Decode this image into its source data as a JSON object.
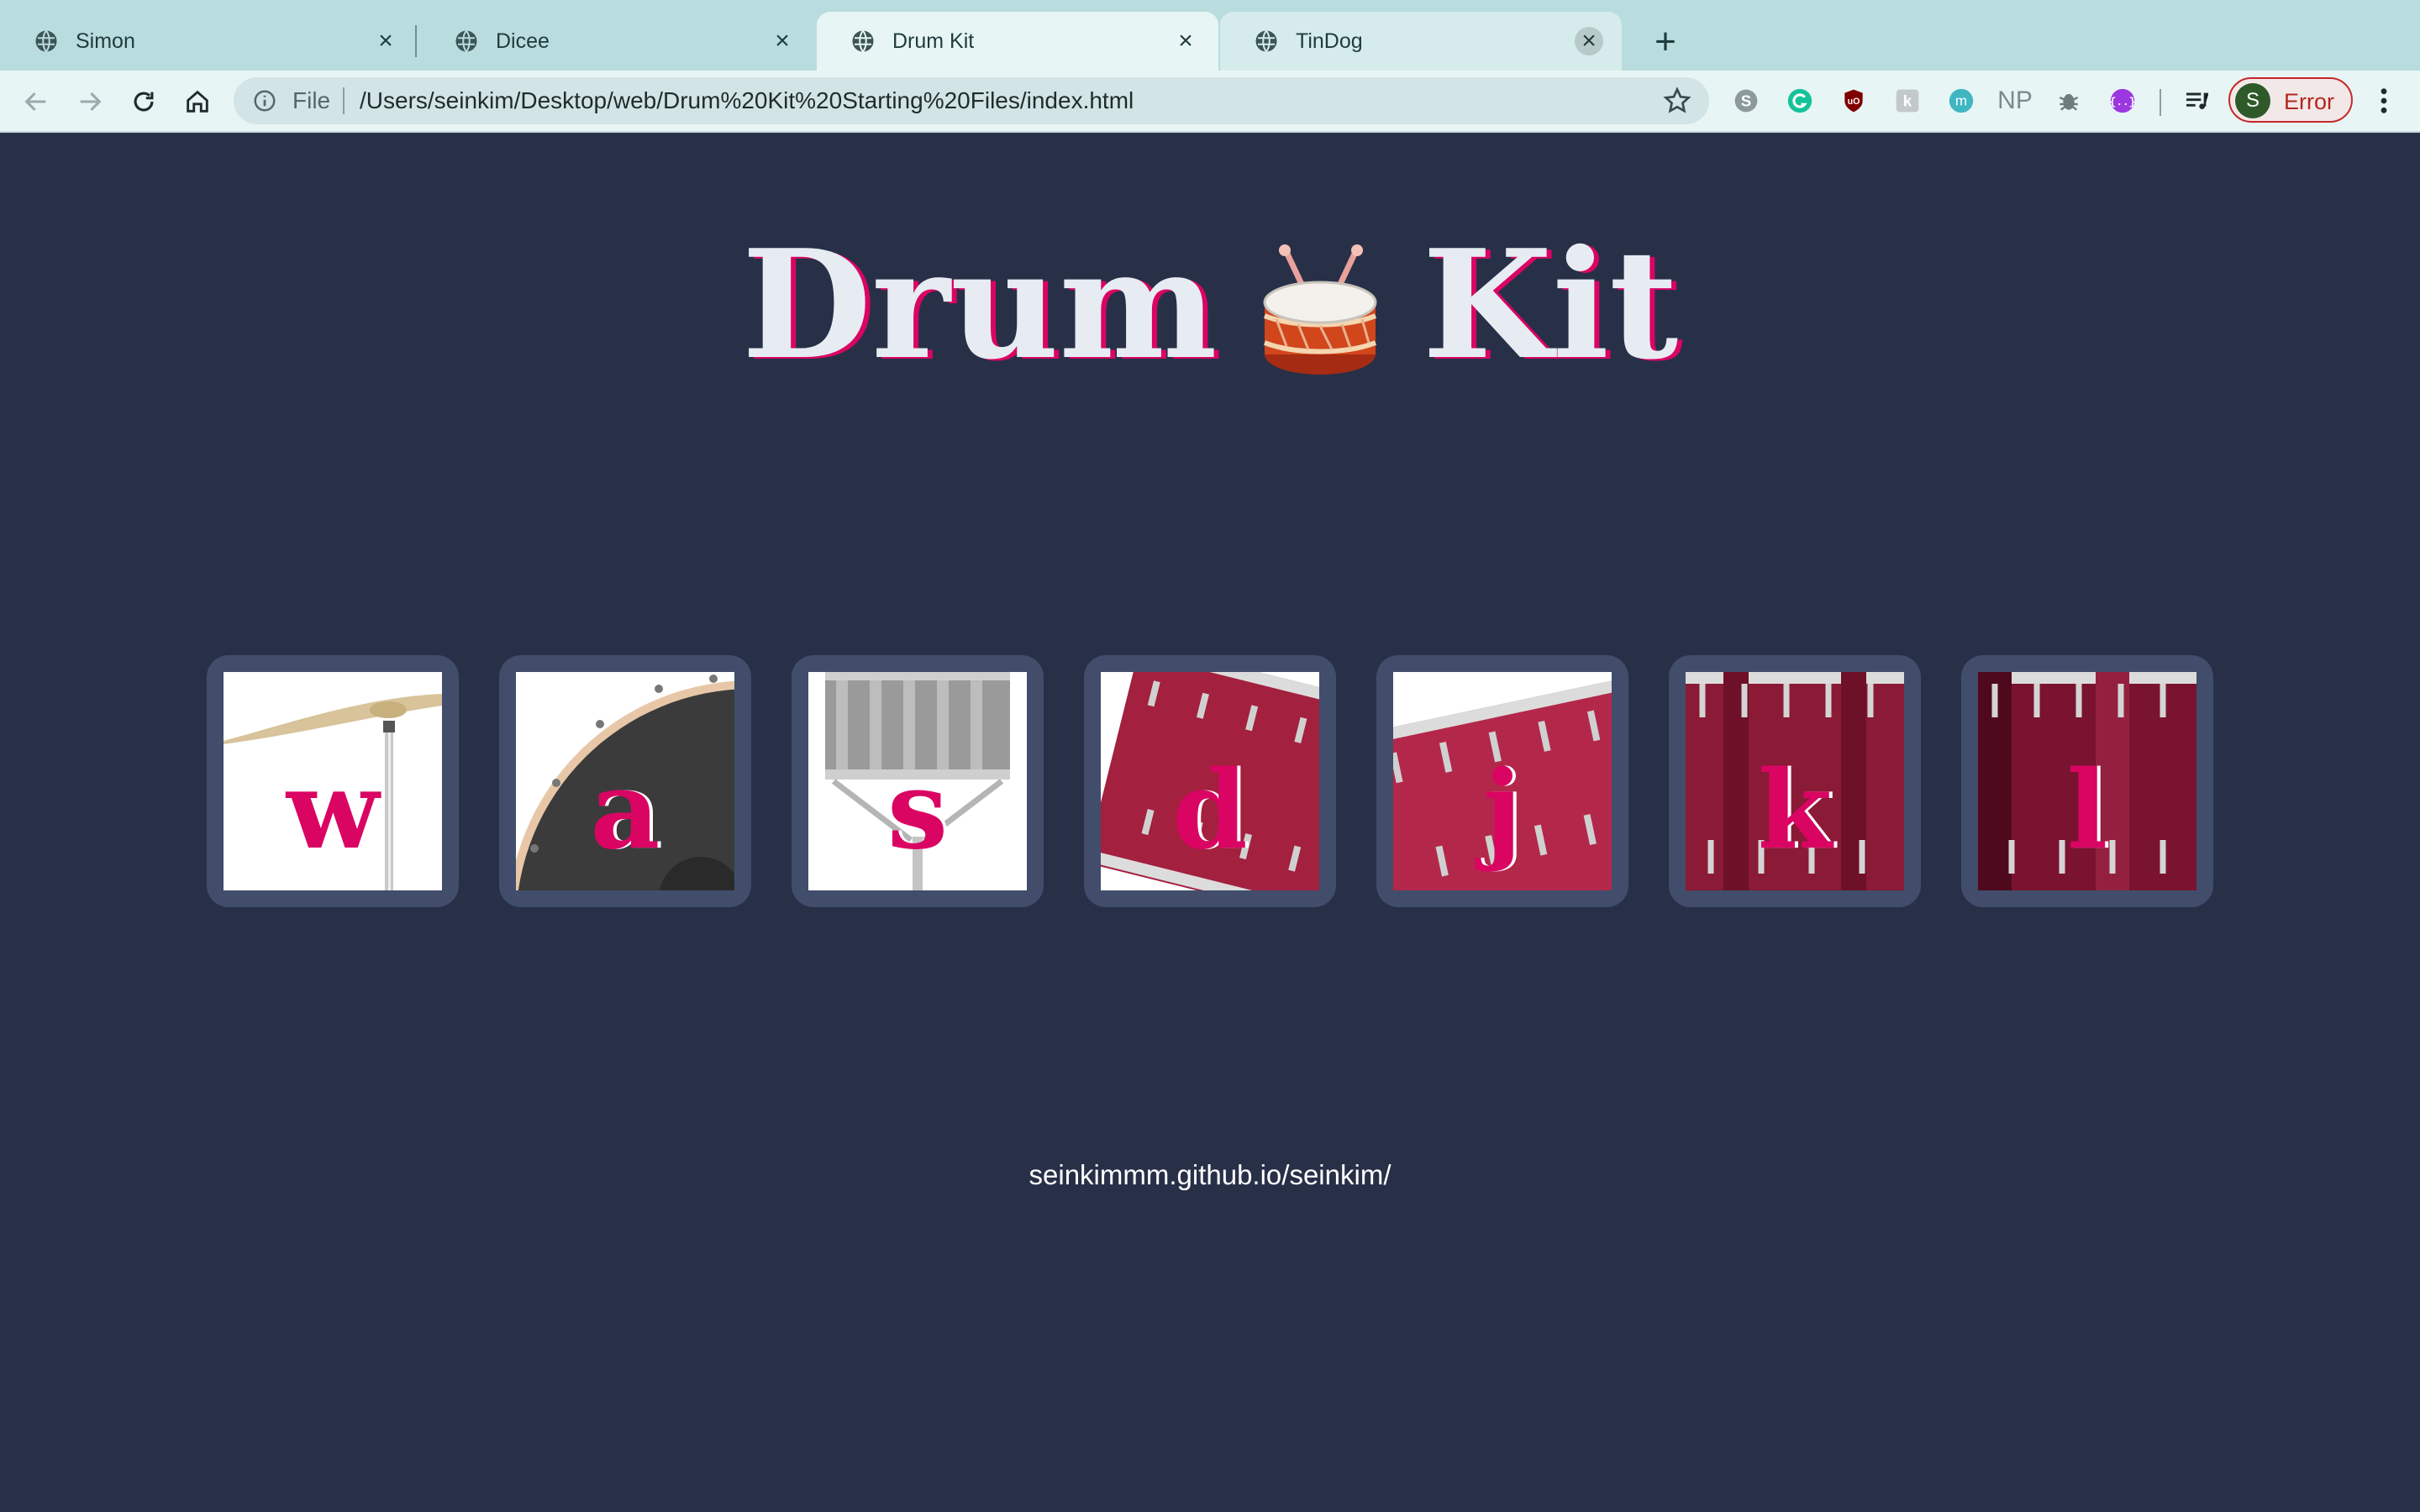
{
  "browser": {
    "tabs": [
      {
        "title": "Simon"
      },
      {
        "title": "Dicee"
      },
      {
        "title": "Drum Kit"
      },
      {
        "title": "TinDog"
      }
    ],
    "address": {
      "scheme_label": "File",
      "url": "/Users/seinkim/Desktop/web/Drum%20Kit%20Starting%20Files/index.html"
    },
    "extensions": [
      "skype-icon",
      "grammarly-icon",
      "ublock-icon",
      "kami-icon",
      "mercury-icon",
      "np-icon",
      "bug-icon",
      "code-icon"
    ],
    "extension_text_np": "NP",
    "profile": {
      "initial": "S",
      "status": "Error"
    }
  },
  "page": {
    "title_left": "Drum",
    "title_right": "Kit",
    "title_icon": "drum-emoji",
    "drums": [
      {
        "key": "w",
        "instrument": "crash"
      },
      {
        "key": "a",
        "instrument": "kick-bass"
      },
      {
        "key": "s",
        "instrument": "snare"
      },
      {
        "key": "d",
        "instrument": "tom1"
      },
      {
        "key": "j",
        "instrument": "tom2"
      },
      {
        "key": "k",
        "instrument": "tom3"
      },
      {
        "key": "l",
        "instrument": "tom4"
      }
    ],
    "footer": "seinkimmm.github.io/seinkim/"
  },
  "colors": {
    "background": "#283048",
    "accent": "#da0463",
    "tile": "#414d6b",
    "title": "#e6ecf2",
    "tabstrip": "#b9dcde"
  }
}
